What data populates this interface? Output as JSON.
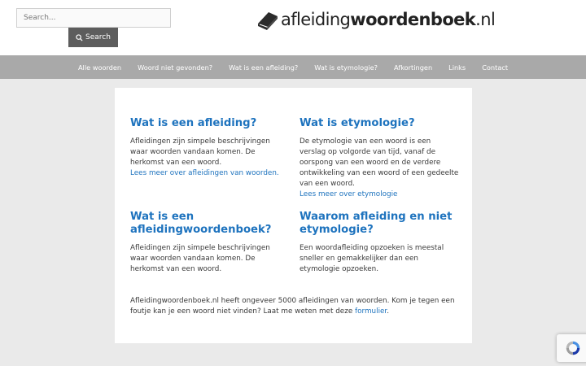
{
  "search": {
    "placeholder": "Search...",
    "value": "",
    "button_label": "Search"
  },
  "logo": {
    "prefix": "afleiding",
    "bold": "woordenboek",
    "suffix": ".nl"
  },
  "nav": {
    "items": [
      {
        "label": "Alle woorden"
      },
      {
        "label": "Woord niet gevonden?"
      },
      {
        "label": "Wat is een afleiding?"
      },
      {
        "label": "Wat is etymologie?"
      },
      {
        "label": "Afkortingen"
      },
      {
        "label": "Links"
      },
      {
        "label": "Contact"
      }
    ]
  },
  "sections": [
    {
      "title": "Wat is een afleiding?",
      "text": "Afleidingen zijn simpele beschrijvingen waar woorden vandaan komen. De herkomst van een woord.",
      "link": "Lees meer over afleidingen van woorden."
    },
    {
      "title": "Wat is etymologie?",
      "text": "De etymologie van een woord is een verslag op volgorde van tijd, vanaf de oorspong van een woord en de verdere ontwikkeling van een woord of een gedeelte van een woord.",
      "link": "Lees meer over etymologie"
    },
    {
      "title": "Wat is een afleidingwoordenboek?",
      "text": "Afleidingen zijn simpele beschrijvingen waar woorden vandaan komen. De herkomst van een woord."
    },
    {
      "title": "Waarom afleiding en niet etymologie?",
      "text": "Een woordafleiding opzoeken is meestal sneller en gemakkelijker dan een etymologie opzoeken."
    }
  ],
  "footer": {
    "text": "Afleidingwoordenboek.nl heeft ongeveer 5000 afleidingen van woorden. Kom je tegen een foutje kan je een woord niet vinden? Laat me weten met deze",
    "link": "formulier",
    "end": "."
  },
  "colors": {
    "accent": "#1e73be",
    "nav_bg": "#a9a9a9",
    "page_bg": "#eaeaea",
    "button_bg": "#5d5d5d"
  },
  "icons": {
    "search": "search-icon",
    "logo": "book-icon",
    "recaptcha": "recaptcha-icon"
  }
}
